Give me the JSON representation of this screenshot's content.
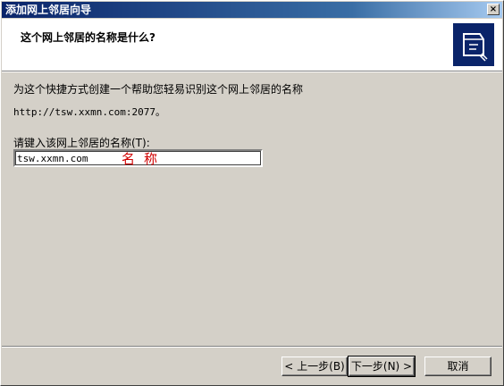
{
  "window": {
    "title": "添加网上邻居向导",
    "close_label": "×"
  },
  "header": {
    "title": "这个网上邻居的名称是什么?"
  },
  "body": {
    "description": "为这个快捷方式创建一个帮助您轻易识别这个网上邻居的名称",
    "url": "http://tsw.xxmn.com:2077。",
    "field_label": "请键入该网上邻居的名称(T):",
    "field_value": "tsw.xxmn.com",
    "annotation": "名称"
  },
  "buttons": {
    "back": "< 上一步(B)",
    "next": "下一步(N) >",
    "cancel": "取消"
  },
  "colors": {
    "titlebar": "#0a246a",
    "annotation": "#d00000",
    "dialog_bg": "#d4d0c8"
  }
}
